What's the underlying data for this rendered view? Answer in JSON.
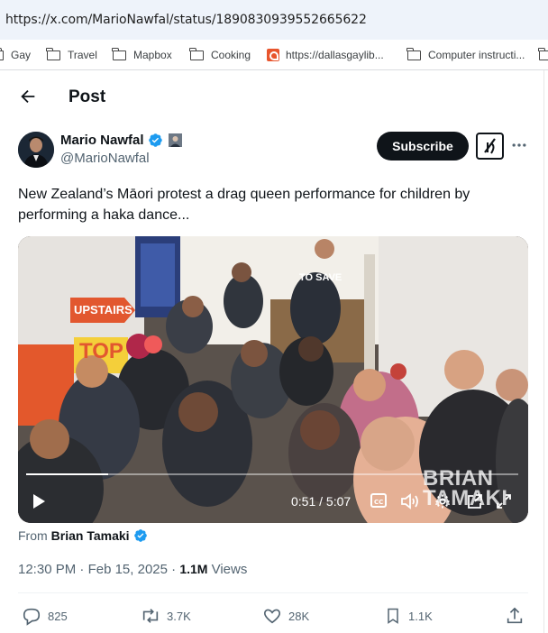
{
  "browser": {
    "url": "https://x.com/MarioNawfal/status/1890830939552665622",
    "bookmarks": [
      "Gay",
      "Travel",
      "Mapbox",
      "Cooking",
      "https://dallasgaylib...",
      "Computer instructi..."
    ]
  },
  "header": {
    "title": "Post"
  },
  "author": {
    "name": "Mario Nawfal",
    "handle": "@MarioNawfal"
  },
  "buttons": {
    "subscribe": "Subscribe"
  },
  "tweet": {
    "text": "New Zealand’s Māori protest a drag queen performance for children by performing a haka dance..."
  },
  "video": {
    "time": "0:51 / 5:07",
    "progress": 0.166,
    "watermark_line1": "BRIAN",
    "watermark_line2": "TAMAKI",
    "signs": {
      "upstairs": "UPSTAIRS",
      "top": "TOP",
      "save": "TO SAVE"
    }
  },
  "from": {
    "prefix": "From",
    "name": "Brian Tamaki"
  },
  "meta": {
    "time": "12:30 PM",
    "sep": " · ",
    "date": "Feb 15, 2025",
    "views_count": "1.1M",
    "views_label": "Views"
  },
  "actions": {
    "replies": "825",
    "reposts": "3.7K",
    "likes": "28K",
    "bookmarks": "1.1K"
  },
  "colors": {
    "accent_blue": "#1d9bf0",
    "text": "#0f1419",
    "muted": "#536471",
    "urlbar_bg": "#eef3fa"
  }
}
